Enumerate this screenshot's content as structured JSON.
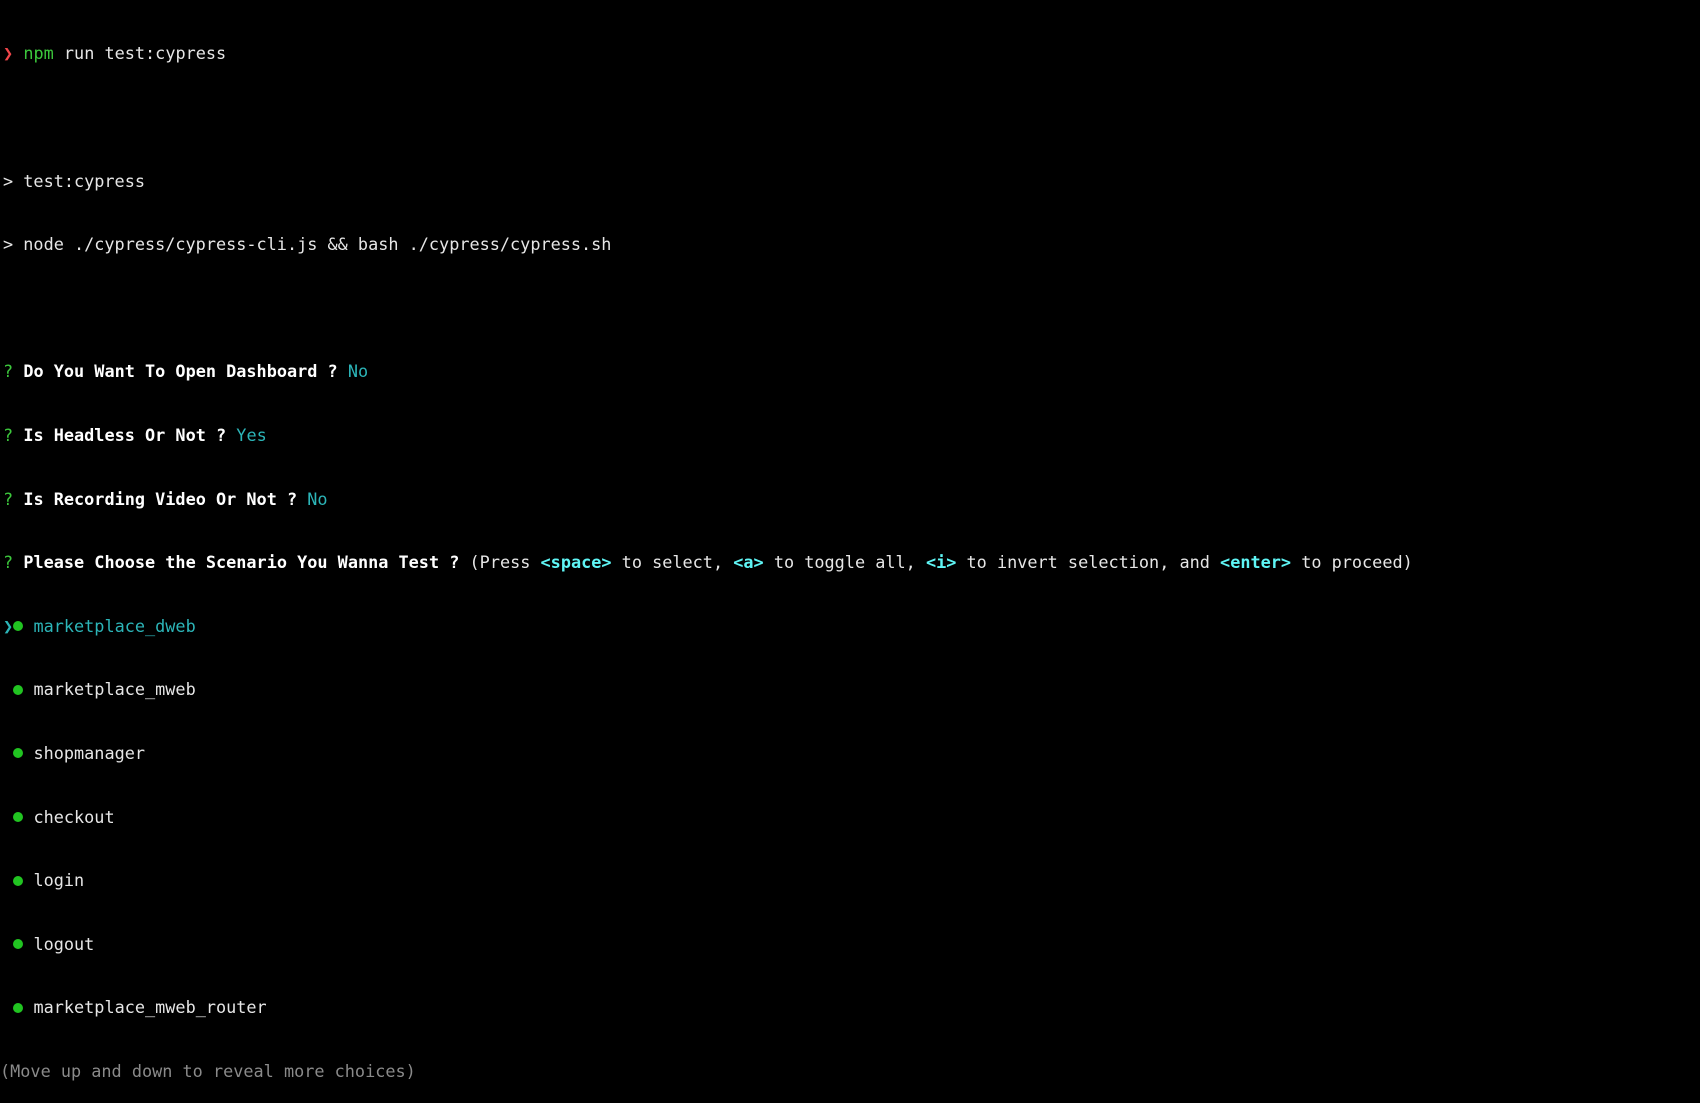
{
  "colors": {
    "prompt": "#f0464a",
    "success": "#3cc83c",
    "answer": "#2cb5b8",
    "key": "#5ff5f5",
    "hint": "#8a8a8a"
  },
  "command": {
    "prompt_symbol": "❯",
    "program": "npm",
    "args": "run test:cypress"
  },
  "script_echo": [
    "> test:cypress",
    "> node ./cypress/cypress-cli.js && bash ./cypress/cypress.sh"
  ],
  "questions": [
    {
      "mark": "?",
      "text": "Do You Want To Open Dashboard ?",
      "answer": "No"
    },
    {
      "mark": "?",
      "text": "Is Headless Or Not ?",
      "answer": "Yes"
    },
    {
      "mark": "?",
      "text": "Is Recording Video Or Not ?",
      "answer": "No"
    }
  ],
  "scenario_prompt": {
    "mark": "?",
    "text": "Please Choose the Scenario You Wanna Test ?",
    "p1": "(Press ",
    "k1": "<space>",
    "p2": " to select, ",
    "k2": "<a>",
    "p3": " to toggle all, ",
    "k3": "<i>",
    "p4": " to invert selection, and ",
    "k4": "<enter>",
    "p5": " to proceed)"
  },
  "cursor_symbol": "❯",
  "choices": [
    "marketplace_dweb",
    "marketplace_mweb",
    "shopmanager",
    "checkout",
    "login",
    "logout",
    "marketplace_mweb_router"
  ],
  "active_choice": "marketplace_dweb",
  "more_hint": "(Move up and down to reveal more choices)"
}
